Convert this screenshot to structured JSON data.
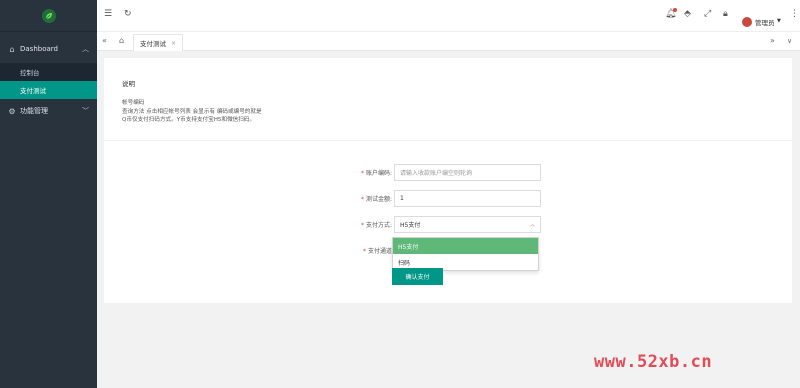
{
  "sidebar": {
    "groups": [
      {
        "label": "Dashboard",
        "icon": "home-icon",
        "expanded": true,
        "items": [
          {
            "label": "控制台"
          },
          {
            "label": "支付测试",
            "active": true
          }
        ]
      },
      {
        "label": "功能管理",
        "icon": "gear-icon",
        "expanded": false
      }
    ]
  },
  "topbar": {
    "user": "管理员"
  },
  "tabs": [
    {
      "label": "支付测试"
    }
  ],
  "card": {
    "title": "说明",
    "desc_lines": [
      "帐号编码",
      "查询方法 点击相应帐号列表 会显示有 编码或编号的就是",
      "Q币仅支付扫码方式。Y币支持支付宝H5和微信扫码。"
    ]
  },
  "form": {
    "account_label": "账户编码:",
    "account_placeholder": "请输入收款账户编空则轮询",
    "amount_label": "测试金额:",
    "amount_value": "1",
    "method_label": "支付方式:",
    "method_value": "H5支付",
    "method_options": [
      "H5支付",
      "扫码"
    ],
    "channel_label": "支付通道",
    "submit_label": "确认支付"
  },
  "watermark": "www.52xb.cn",
  "colors": {
    "sidebar_bg": "#28333e",
    "accent": "#009688",
    "option_selected": "#5fb878",
    "required": "#e0463d",
    "watermark": "#e34b57"
  }
}
